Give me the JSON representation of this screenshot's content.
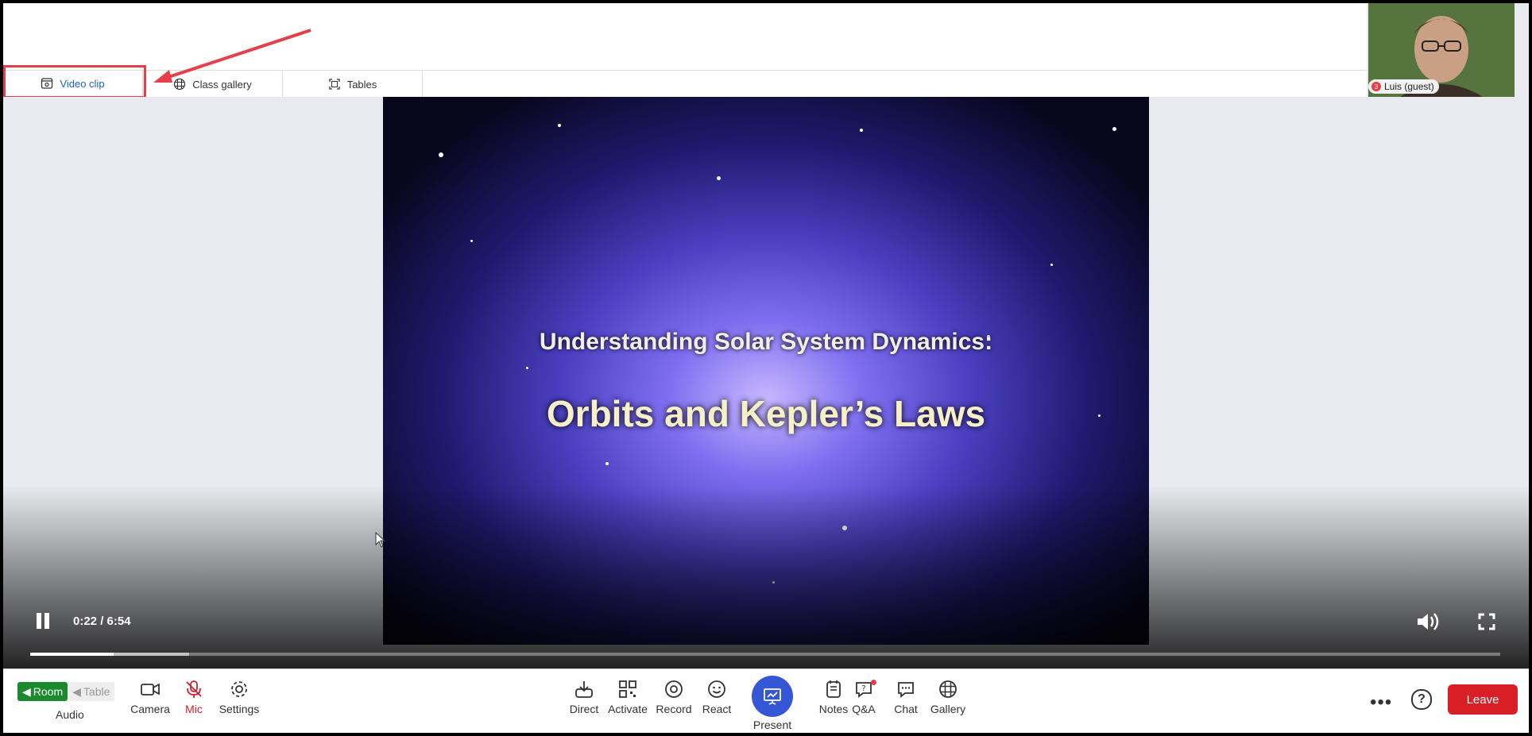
{
  "tabs": [
    {
      "label": "Video clip",
      "icon": "video-clip-icon"
    },
    {
      "label": "Class gallery",
      "icon": "grid-icon"
    },
    {
      "label": "Tables",
      "icon": "tables-icon"
    }
  ],
  "participant": {
    "name": "Luis (guest)",
    "badge": "3"
  },
  "video": {
    "line1": "Understanding Solar System Dynamics:",
    "line2": "Orbits and Kepler’s Laws",
    "current_time": "0:22 / 6:54",
    "played_fraction": 0.057,
    "buffered_fraction": 0.108
  },
  "toolbar": {
    "room_label": "Room",
    "table_label": "Table",
    "audio_label": "Audio",
    "camera_label": "Camera",
    "mic_label": "Mic",
    "settings_label": "Settings",
    "direct_label": "Direct",
    "activate_label": "Activate",
    "record_label": "Record",
    "react_label": "React",
    "present_label": "Present",
    "notes_label": "Notes",
    "qa_label": "Q&A",
    "chat_label": "Chat",
    "gallery_label": "Gallery",
    "more_label": "•••",
    "help_label": "?",
    "leave_label": "Leave"
  },
  "colors": {
    "accent": "#1d63c8",
    "leave": "#d81f26",
    "room_active": "#1a8a2e",
    "present": "#3556d6",
    "highlight": "#e53f4a"
  }
}
